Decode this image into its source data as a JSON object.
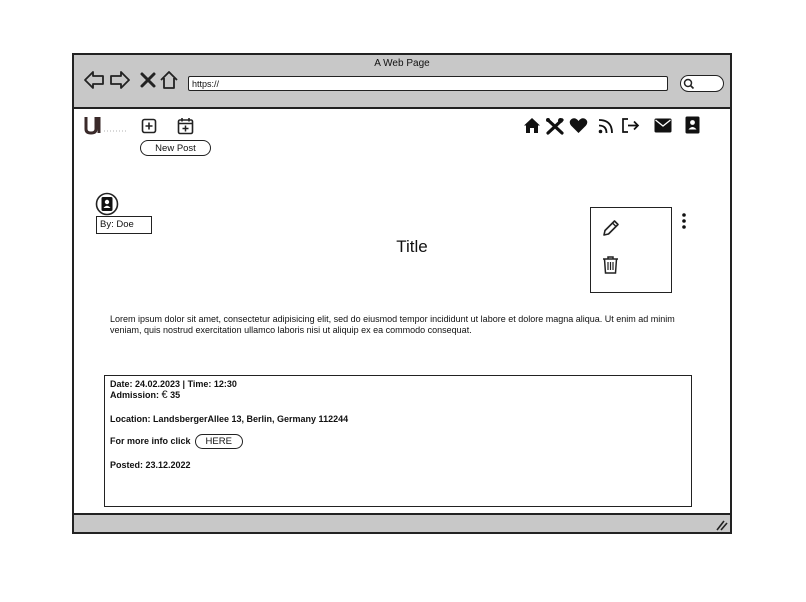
{
  "browser": {
    "title": "A Web Page",
    "url": "https://",
    "nav": [
      "back-icon",
      "forward-icon",
      "close-icon",
      "home-icon"
    ],
    "search_icon": "search-icon"
  },
  "header": {
    "logo_icon": "logo-icon",
    "new_post_icon": "plus-square-icon",
    "calendar_icon": "calendar-plus-icon",
    "tooltip": "New Post",
    "right_icons": [
      "home-icon",
      "tools-icon",
      "heart-icon",
      "rss-icon",
      "sign-out-icon",
      "mail-icon",
      "user-icon"
    ]
  },
  "post": {
    "author_icon": "user-avatar-icon",
    "author": "By: Doe",
    "title": "Title",
    "actions": {
      "edit_icon": "pencil-icon",
      "delete_icon": "trash-icon",
      "more_icon": "more-vertical-icon"
    },
    "body": "Lorem ipsum dolor sit amet, consectetur adipisicing elit, sed do eiusmod tempor incididunt ut labore et dolore magna aliqua. Ut enim ad minim veniam, quis nostrud exercitation ullamco laboris nisi ut aliquip ex ea commodo consequat."
  },
  "details": {
    "date": "Date: 24.02.2023 | Time: 12:30",
    "admission_label": "Admission:",
    "admission_currency": "€",
    "admission_value": "35",
    "location": "Location: LandsbergerAllee 13, Berlin, Germany 112244",
    "more_info": "For more info click",
    "here": "HERE",
    "posted": "Posted: 23.12.2022"
  }
}
